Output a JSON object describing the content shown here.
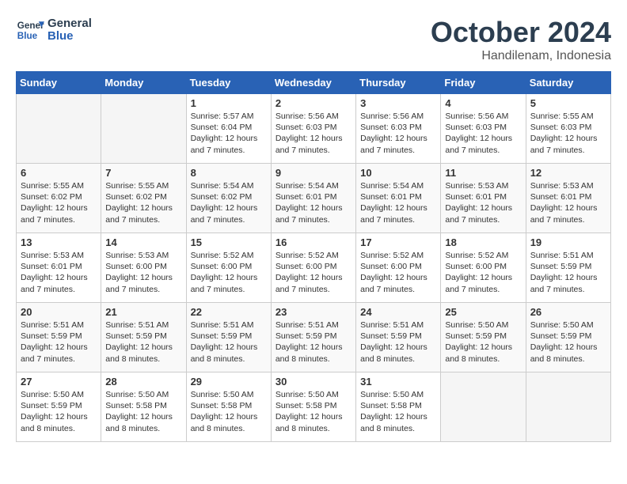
{
  "logo": {
    "name_line1": "General",
    "name_line2": "Blue"
  },
  "title": "October 2024",
  "location": "Handilenam, Indonesia",
  "weekdays": [
    "Sunday",
    "Monday",
    "Tuesday",
    "Wednesday",
    "Thursday",
    "Friday",
    "Saturday"
  ],
  "weeks": [
    [
      {
        "day": "",
        "content": ""
      },
      {
        "day": "",
        "content": ""
      },
      {
        "day": "1",
        "content": "Sunrise: 5:57 AM\nSunset: 6:04 PM\nDaylight: 12 hours and 7 minutes."
      },
      {
        "day": "2",
        "content": "Sunrise: 5:56 AM\nSunset: 6:03 PM\nDaylight: 12 hours and 7 minutes."
      },
      {
        "day": "3",
        "content": "Sunrise: 5:56 AM\nSunset: 6:03 PM\nDaylight: 12 hours and 7 minutes."
      },
      {
        "day": "4",
        "content": "Sunrise: 5:56 AM\nSunset: 6:03 PM\nDaylight: 12 hours and 7 minutes."
      },
      {
        "day": "5",
        "content": "Sunrise: 5:55 AM\nSunset: 6:03 PM\nDaylight: 12 hours and 7 minutes."
      }
    ],
    [
      {
        "day": "6",
        "content": "Sunrise: 5:55 AM\nSunset: 6:02 PM\nDaylight: 12 hours and 7 minutes."
      },
      {
        "day": "7",
        "content": "Sunrise: 5:55 AM\nSunset: 6:02 PM\nDaylight: 12 hours and 7 minutes."
      },
      {
        "day": "8",
        "content": "Sunrise: 5:54 AM\nSunset: 6:02 PM\nDaylight: 12 hours and 7 minutes."
      },
      {
        "day": "9",
        "content": "Sunrise: 5:54 AM\nSunset: 6:01 PM\nDaylight: 12 hours and 7 minutes."
      },
      {
        "day": "10",
        "content": "Sunrise: 5:54 AM\nSunset: 6:01 PM\nDaylight: 12 hours and 7 minutes."
      },
      {
        "day": "11",
        "content": "Sunrise: 5:53 AM\nSunset: 6:01 PM\nDaylight: 12 hours and 7 minutes."
      },
      {
        "day": "12",
        "content": "Sunrise: 5:53 AM\nSunset: 6:01 PM\nDaylight: 12 hours and 7 minutes."
      }
    ],
    [
      {
        "day": "13",
        "content": "Sunrise: 5:53 AM\nSunset: 6:01 PM\nDaylight: 12 hours and 7 minutes."
      },
      {
        "day": "14",
        "content": "Sunrise: 5:53 AM\nSunset: 6:00 PM\nDaylight: 12 hours and 7 minutes."
      },
      {
        "day": "15",
        "content": "Sunrise: 5:52 AM\nSunset: 6:00 PM\nDaylight: 12 hours and 7 minutes."
      },
      {
        "day": "16",
        "content": "Sunrise: 5:52 AM\nSunset: 6:00 PM\nDaylight: 12 hours and 7 minutes."
      },
      {
        "day": "17",
        "content": "Sunrise: 5:52 AM\nSunset: 6:00 PM\nDaylight: 12 hours and 7 minutes."
      },
      {
        "day": "18",
        "content": "Sunrise: 5:52 AM\nSunset: 6:00 PM\nDaylight: 12 hours and 7 minutes."
      },
      {
        "day": "19",
        "content": "Sunrise: 5:51 AM\nSunset: 5:59 PM\nDaylight: 12 hours and 7 minutes."
      }
    ],
    [
      {
        "day": "20",
        "content": "Sunrise: 5:51 AM\nSunset: 5:59 PM\nDaylight: 12 hours and 7 minutes."
      },
      {
        "day": "21",
        "content": "Sunrise: 5:51 AM\nSunset: 5:59 PM\nDaylight: 12 hours and 8 minutes."
      },
      {
        "day": "22",
        "content": "Sunrise: 5:51 AM\nSunset: 5:59 PM\nDaylight: 12 hours and 8 minutes."
      },
      {
        "day": "23",
        "content": "Sunrise: 5:51 AM\nSunset: 5:59 PM\nDaylight: 12 hours and 8 minutes."
      },
      {
        "day": "24",
        "content": "Sunrise: 5:51 AM\nSunset: 5:59 PM\nDaylight: 12 hours and 8 minutes."
      },
      {
        "day": "25",
        "content": "Sunrise: 5:50 AM\nSunset: 5:59 PM\nDaylight: 12 hours and 8 minutes."
      },
      {
        "day": "26",
        "content": "Sunrise: 5:50 AM\nSunset: 5:59 PM\nDaylight: 12 hours and 8 minutes."
      }
    ],
    [
      {
        "day": "27",
        "content": "Sunrise: 5:50 AM\nSunset: 5:59 PM\nDaylight: 12 hours and 8 minutes."
      },
      {
        "day": "28",
        "content": "Sunrise: 5:50 AM\nSunset: 5:58 PM\nDaylight: 12 hours and 8 minutes."
      },
      {
        "day": "29",
        "content": "Sunrise: 5:50 AM\nSunset: 5:58 PM\nDaylight: 12 hours and 8 minutes."
      },
      {
        "day": "30",
        "content": "Sunrise: 5:50 AM\nSunset: 5:58 PM\nDaylight: 12 hours and 8 minutes."
      },
      {
        "day": "31",
        "content": "Sunrise: 5:50 AM\nSunset: 5:58 PM\nDaylight: 12 hours and 8 minutes."
      },
      {
        "day": "",
        "content": ""
      },
      {
        "day": "",
        "content": ""
      }
    ]
  ]
}
